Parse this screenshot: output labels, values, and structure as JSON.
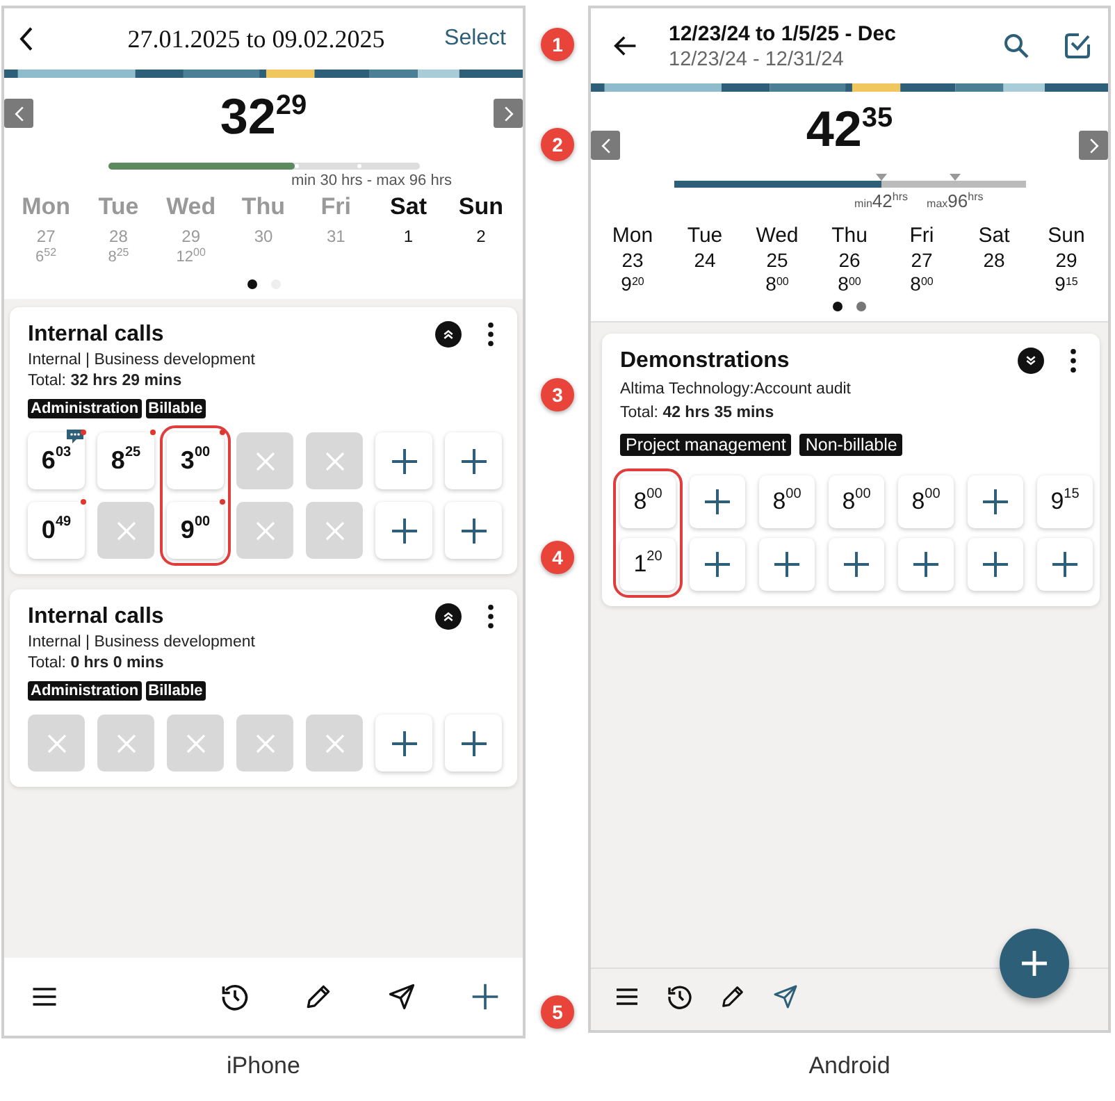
{
  "phones": [
    {
      "kind": "iphone",
      "caption": "iPhone",
      "header": {
        "title": "27.01.2025 to 09.02.2025",
        "action": "Select"
      },
      "summary": {
        "total": "32$^{29}$",
        "level": 0.6,
        "range": "min 30 hrs - max 96 hrs"
      },
      "days": [
        {
          "name": "Mon",
          "date": "27",
          "hours": "6$^{52}$",
          "dimmed": true
        },
        {
          "name": "Tue",
          "date": "28",
          "hours": "8$^{25}$",
          "dimmed": true
        },
        {
          "name": "Wed",
          "date": "29",
          "hours": "12$^{00}$",
          "dimmed": true
        },
        {
          "name": "Thu",
          "date": "30",
          "dimmed": true
        },
        {
          "name": "Fri",
          "date": "31",
          "dimmed": true
        },
        {
          "name": "Sat",
          "date": "1",
          "dimmed": false
        },
        {
          "name": "Sun",
          "date": "2",
          "dimmed": false
        }
      ],
      "pages": [
        {
          "selected": true
        },
        {
          "selected": false
        }
      ],
      "cards": [
        {
          "title": "Internal calls",
          "subtitle": "Internal | Business development",
          "total": "Total:  **32 hrs 29 mins**",
          "tags": [
            "Administration",
            "Billable"
          ],
          "expanded": true,
          "columns": [
            {
              "highlighted": false,
              "cells": [
                {
                  "kind": "time",
                  "value": "6$^{03}$",
                  "note": true,
                  "flagged": true
                },
                {
                  "kind": "time",
                  "value": "0$^{49}$",
                  "note": false,
                  "flagged": true
                }
              ]
            },
            {
              "highlighted": false,
              "cells": [
                {
                  "kind": "time",
                  "value": "8$^{25}$",
                  "note": false,
                  "flagged": true
                },
                {
                  "kind": "blocked"
                }
              ]
            },
            {
              "highlighted": true,
              "cells": [
                {
                  "kind": "time",
                  "value": "3$^{00}$",
                  "note": false,
                  "flagged": true
                },
                {
                  "kind": "time",
                  "value": "9$^{00}$",
                  "note": false,
                  "flagged": true
                }
              ]
            },
            {
              "highlighted": false,
              "cells": [
                {
                  "kind": "blocked"
                },
                {
                  "kind": "blocked"
                }
              ]
            },
            {
              "highlighted": false,
              "cells": [
                {
                  "kind": "blocked"
                },
                {
                  "kind": "blocked"
                }
              ]
            },
            {
              "highlighted": false,
              "cells": [
                {
                  "kind": "add"
                },
                {
                  "kind": "add"
                }
              ]
            },
            {
              "highlighted": false,
              "cells": [
                {
                  "kind": "add"
                },
                {
                  "kind": "add"
                }
              ]
            }
          ]
        },
        {
          "title": "Internal calls",
          "subtitle": "Internal | Business development",
          "total": "Total:  **0 hrs 0 mins**",
          "tags": [
            "Administration",
            "Billable"
          ],
          "expanded": true,
          "columns": [
            {
              "highlighted": false,
              "cells": [
                {
                  "kind": "blocked"
                }
              ]
            },
            {
              "highlighted": false,
              "cells": [
                {
                  "kind": "blocked"
                }
              ]
            },
            {
              "highlighted": false,
              "cells": [
                {
                  "kind": "blocked"
                }
              ]
            },
            {
              "highlighted": false,
              "cells": [
                {
                  "kind": "blocked"
                }
              ]
            },
            {
              "highlighted": false,
              "cells": [
                {
                  "kind": "blocked"
                }
              ]
            },
            {
              "highlighted": false,
              "cells": [
                {
                  "kind": "add"
                }
              ]
            },
            {
              "highlighted": false,
              "cells": [
                {
                  "kind": "add"
                }
              ]
            }
          ]
        }
      ],
      "toolbar": [
        {
          "kind": "menu",
          "active": false
        },
        {
          "kind": "history",
          "active": false
        },
        {
          "kind": "edit",
          "active": false
        },
        {
          "kind": "send",
          "active": false
        },
        {
          "kind": "add",
          "active": true
        }
      ]
    },
    {
      "kind": "android",
      "caption": "Android",
      "header": {
        "title": "12/23/24 to 1/5/25 - Dec",
        "subtitle": "12/23/24 - 12/31/24"
      },
      "summary": {
        "total": "42$^{35}$",
        "level": 0.59,
        "min": "$_{min}$42$^{hrs}$",
        "max": "$_{max}$96$^{hrs}$"
      },
      "days": [
        {
          "name": "Mon",
          "date": "23",
          "hours": "9$^{20}$"
        },
        {
          "name": "Tue",
          "date": "24"
        },
        {
          "name": "Wed",
          "date": "25",
          "hours": "8$^{00}$"
        },
        {
          "name": "Thu",
          "date": "26",
          "hours": "8$^{00}$"
        },
        {
          "name": "Fri",
          "date": "27",
          "hours": "8$^{00}$"
        },
        {
          "name": "Sat",
          "date": "28"
        },
        {
          "name": "Sun",
          "date": "29",
          "hours": "9$^{15}$"
        }
      ],
      "pages": [
        {
          "selected": true
        },
        {
          "selected": false
        }
      ],
      "cards": [
        {
          "title": "Demonstrations",
          "subtitle": "Altima Technology:Account audit",
          "total": "Total: **42 hrs 35 mins**",
          "tags": [
            "Project management",
            "Non-billable"
          ],
          "expanded": false,
          "columns": [
            {
              "highlighted": true,
              "cells": [
                {
                  "kind": "time",
                  "value": "8$^{00}$"
                },
                {
                  "kind": "time",
                  "value": "1$^{20}$"
                }
              ]
            },
            {
              "highlighted": false,
              "cells": [
                {
                  "kind": "add"
                },
                {
                  "kind": "add"
                }
              ]
            },
            {
              "highlighted": false,
              "cells": [
                {
                  "kind": "time",
                  "value": "8$^{00}$"
                },
                {
                  "kind": "add"
                }
              ]
            },
            {
              "highlighted": false,
              "cells": [
                {
                  "kind": "time",
                  "value": "8$^{00}$"
                },
                {
                  "kind": "add"
                }
              ]
            },
            {
              "highlighted": false,
              "cells": [
                {
                  "kind": "time",
                  "value": "8$^{00}$"
                },
                {
                  "kind": "add"
                }
              ]
            },
            {
              "highlighted": false,
              "cells": [
                {
                  "kind": "add"
                },
                {
                  "kind": "add"
                }
              ]
            },
            {
              "highlighted": false,
              "cells": [
                {
                  "kind": "time",
                  "value": "9$^{15}$"
                },
                {
                  "kind": "add"
                }
              ]
            }
          ]
        }
      ],
      "toolbar": [
        {
          "kind": "menu",
          "active": false
        },
        {
          "kind": "history",
          "active": false
        },
        {
          "kind": "edit",
          "active": false
        },
        {
          "kind": "send",
          "active": true
        }
      ],
      "fab": {
        "kind": "add"
      }
    }
  ],
  "callouts": [
    "1",
    "2",
    "3",
    "4",
    "5"
  ]
}
